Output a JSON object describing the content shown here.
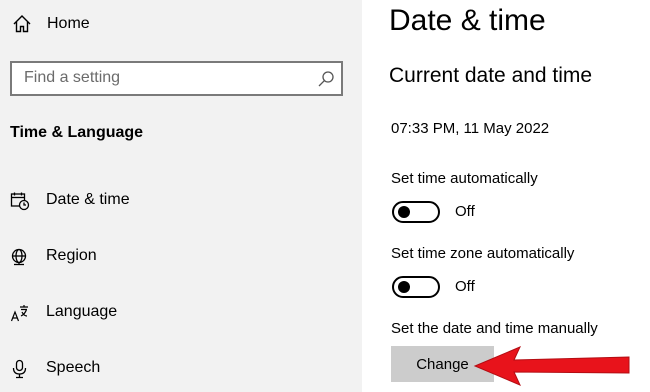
{
  "sidebar": {
    "home_label": "Home",
    "search_placeholder": "Find a setting",
    "section_title": "Time & Language",
    "items": [
      {
        "label": "Date & time",
        "icon": "date-time-icon"
      },
      {
        "label": "Region",
        "icon": "globe-icon"
      },
      {
        "label": "Language",
        "icon": "language-icon"
      },
      {
        "label": "Speech",
        "icon": "microphone-icon"
      }
    ]
  },
  "main": {
    "title": "Date & time",
    "subtitle": "Current date and time",
    "current_datetime": "07:33 PM, 11 May 2022",
    "set_time_auto": {
      "label": "Set time automatically",
      "state": "Off",
      "on": false
    },
    "set_zone_auto": {
      "label": "Set time zone automatically",
      "state": "Off",
      "on": false
    },
    "manual": {
      "label": "Set the date and time manually",
      "button_label": "Change"
    }
  },
  "annotation": {
    "arrow_color": "#e8131b"
  },
  "colors": {
    "sidebar_bg": "#f2f2f2",
    "button_bg": "#cccccc"
  }
}
